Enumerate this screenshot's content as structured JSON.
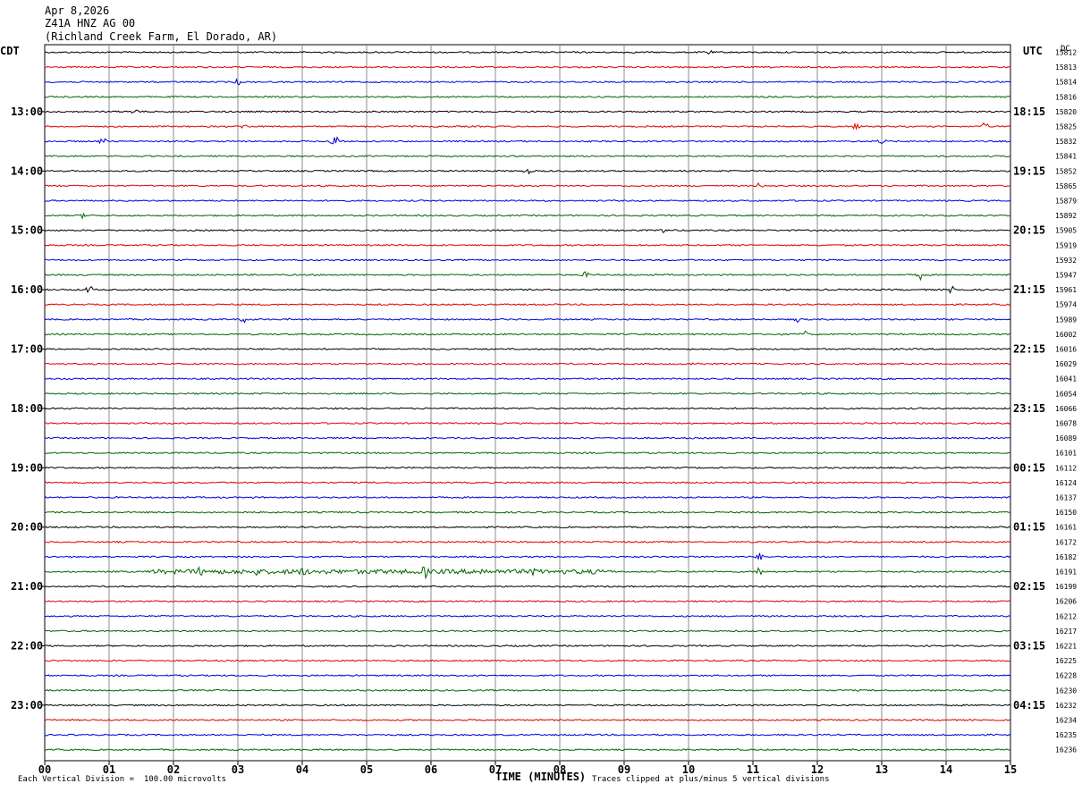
{
  "header": {
    "date": "Apr 8,2026",
    "station": "Z41A HNZ AG 00",
    "location": "(Richland Creek Farm, El Dorado, AR)"
  },
  "left_axis_title": "CDT",
  "right_axis_title": "UTC",
  "dc_title": "DC",
  "footer": {
    "scale_note": "Each Vertical Division =  100.00 microvolts",
    "xlabel": "TIME (MINUTES)",
    "clip_note": "Traces clipped at plus/minus 5 vertical divisions"
  },
  "chart_data": {
    "type": "line",
    "title": "",
    "xlabel": "TIME (MINUTES)",
    "xlim": [
      0,
      15
    ],
    "x_ticks": [
      "00",
      "01",
      "02",
      "03",
      "04",
      "05",
      "06",
      "07",
      "08",
      "09",
      "10",
      "11",
      "12",
      "13",
      "14",
      "15"
    ],
    "trace_colors": [
      "#000000",
      "#dd0000",
      "#0000dd",
      "#006600"
    ],
    "left_time_labels": [
      "13:00",
      "14:00",
      "15:00",
      "16:00",
      "17:00",
      "18:00",
      "19:00",
      "20:00",
      "21:00",
      "22:00",
      "23:00"
    ],
    "right_time_labels": [
      "18:15",
      "19:15",
      "20:15",
      "21:15",
      "22:15",
      "23:15",
      "00:15",
      "01:15",
      "02:15",
      "03:15",
      "04:15"
    ],
    "hour_label_start_trace": 4,
    "dc_offsets": [
      15812,
      15813,
      15814,
      15816,
      15820,
      15825,
      15832,
      15841,
      15852,
      15865,
      15879,
      15892,
      15905,
      15919,
      15932,
      15947,
      15961,
      15974,
      15989,
      16002,
      16016,
      16029,
      16041,
      16054,
      16066,
      16078,
      16089,
      16101,
      16112,
      16124,
      16137,
      16150,
      16161,
      16172,
      16182,
      16191,
      16199,
      16206,
      16212,
      16217,
      16221,
      16225,
      16228,
      16230,
      16232,
      16234,
      16235,
      16236
    ],
    "events": [
      {
        "trace": 0,
        "minute": 10.3,
        "amp": 3
      },
      {
        "trace": 2,
        "minute": 3.0,
        "amp": 3
      },
      {
        "trace": 4,
        "minute": 1.4,
        "amp": 4
      },
      {
        "trace": 5,
        "minute": 3.1,
        "amp": 3
      },
      {
        "trace": 5,
        "minute": 12.6,
        "amp": 3
      },
      {
        "trace": 5,
        "minute": 14.6,
        "amp": 4
      },
      {
        "trace": 6,
        "minute": 0.9,
        "amp": 4
      },
      {
        "trace": 6,
        "minute": 4.5,
        "amp": 10
      },
      {
        "trace": 6,
        "minute": 13.0,
        "amp": 3
      },
      {
        "trace": 8,
        "minute": 7.5,
        "amp": 3
      },
      {
        "trace": 9,
        "minute": 11.1,
        "amp": 3
      },
      {
        "trace": 11,
        "minute": 0.6,
        "amp": 3
      },
      {
        "trace": 12,
        "minute": 9.6,
        "amp": 3
      },
      {
        "trace": 15,
        "minute": 8.4,
        "amp": 3
      },
      {
        "trace": 15,
        "minute": 13.6,
        "amp": 5
      },
      {
        "trace": 16,
        "minute": 0.7,
        "amp": 5
      },
      {
        "trace": 16,
        "minute": 14.1,
        "amp": 5
      },
      {
        "trace": 18,
        "minute": 3.1,
        "amp": 3
      },
      {
        "trace": 18,
        "minute": 11.7,
        "amp": 3
      },
      {
        "trace": 19,
        "minute": 11.8,
        "amp": 4
      },
      {
        "trace": 21,
        "minute": 10.1,
        "amp": 3
      },
      {
        "trace": 34,
        "minute": 11.1,
        "amp": 4
      },
      {
        "trace": 35,
        "minute": 2.4,
        "amp": 6
      },
      {
        "trace": 35,
        "minute": 3.3,
        "amp": 5
      },
      {
        "trace": 35,
        "minute": 4.0,
        "amp": 6
      },
      {
        "trace": 35,
        "minute": 5.9,
        "amp": 8
      },
      {
        "trace": 35,
        "minute": 6.8,
        "amp": 6
      },
      {
        "trace": 35,
        "minute": 7.6,
        "amp": 5
      },
      {
        "trace": 35,
        "minute": 11.1,
        "amp": 7
      }
    ],
    "noisy_segments": [
      {
        "trace": 35,
        "from": 1.6,
        "to": 8.8,
        "amp": 2.5
      }
    ]
  }
}
